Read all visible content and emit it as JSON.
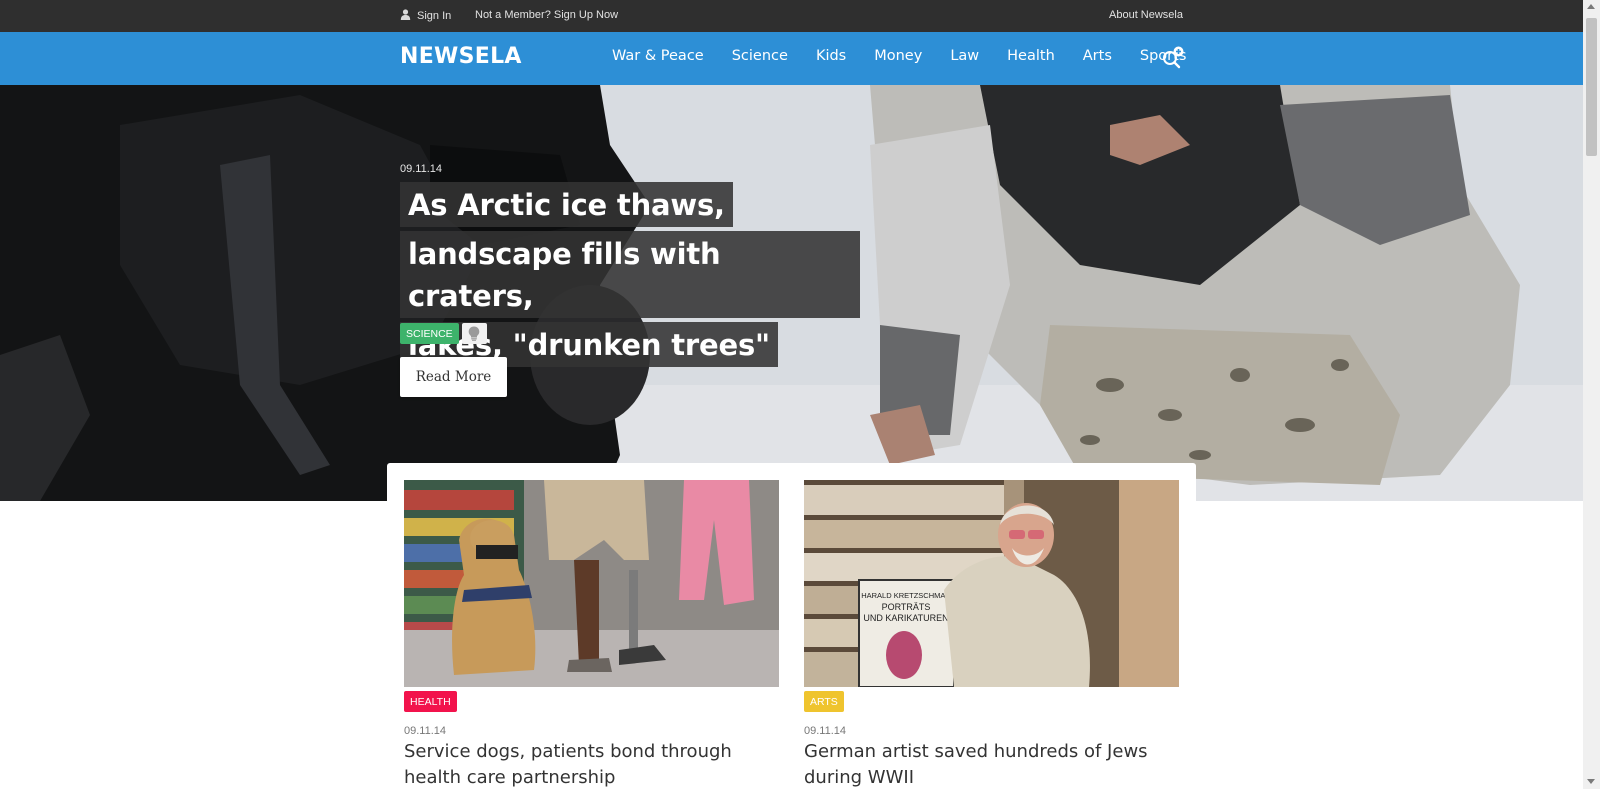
{
  "topbar": {
    "sign_in": "Sign In",
    "sign_up": "Not a Member? Sign Up Now",
    "about": "About Newsela"
  },
  "header": {
    "logo": "NEWSELA",
    "nav": [
      "War & Peace",
      "Science",
      "Kids",
      "Money",
      "Law",
      "Health",
      "Arts",
      "Sports"
    ],
    "search_icon": "search-plus-icon"
  },
  "hero": {
    "date": "09.11.14",
    "title_lines": [
      "As Arctic ice thaws,",
      "landscape fills with craters,",
      "lakes, \"drunken trees\""
    ],
    "tag": "SCIENCE",
    "tag_icon": "lightbulb-icon",
    "read_more": "Read More"
  },
  "articles": [
    {
      "tag": "HEALTH",
      "date": "09.11.14",
      "title": "Service dogs, patients bond through health care partnership",
      "image": "service-dog-photo"
    },
    {
      "tag": "ARTS",
      "date": "09.11.14",
      "title": "German artist saved hundreds of Jews during WWII",
      "image": "artist-with-book-photo",
      "book_lines": [
        "HARALD KRETZSCHMAR",
        "PORTRÄTS",
        "UND KARIKATUREN"
      ]
    }
  ],
  "colors": {
    "brand_blue": "#2d8fd6",
    "topbar": "#2f2f2f",
    "science": "#3db36b",
    "health": "#f2134c",
    "arts": "#efc42e"
  }
}
